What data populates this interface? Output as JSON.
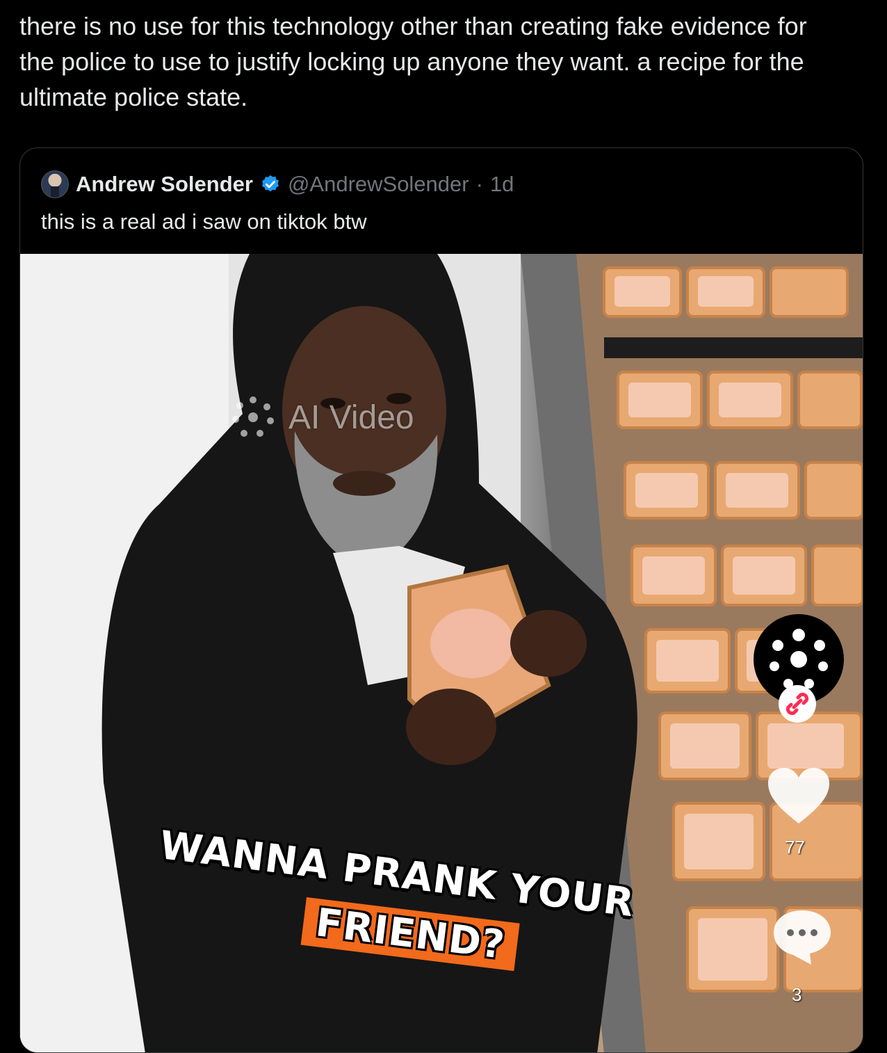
{
  "post": {
    "text": "there is no use for this technology other than creating fake evidence for\nthe police to use to justify locking up anyone they want. a recipe for the\nultimate police state."
  },
  "quoted_post": {
    "author_name": "Andrew Solender",
    "handle": "@AndrewSolender",
    "separator": "·",
    "time": "1d",
    "text": "this is a real ad i saw on tiktok btw",
    "verified_color": "#1d9bf0"
  },
  "video": {
    "watermark": "AI Video",
    "caption_line1": "WANNA PRANK YOUR",
    "caption_line2": "FRIEND?",
    "caption_highlight_color": "#f26a1b",
    "like_count": "77",
    "comment_count": "3"
  }
}
